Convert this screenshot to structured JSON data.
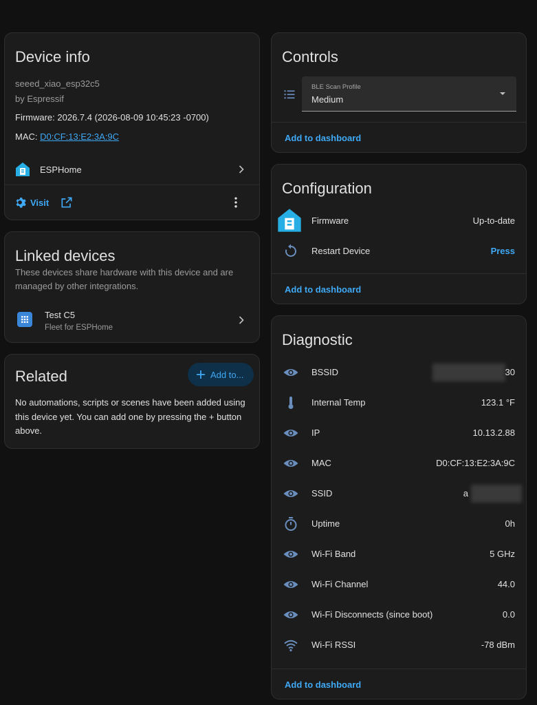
{
  "device_info": {
    "title": "Device info",
    "model": "seeed_xiao_esp32c5",
    "manufacturer": "by Espressif",
    "firmware": "Firmware: 2026.7.4 (2026-08-09 10:45:23 -0700)",
    "mac_label": "MAC: ",
    "mac_value": "D0:CF:13:E2:3A:9C",
    "integration": "ESPHome",
    "visit_label": "Visit"
  },
  "linked_devices": {
    "title": "Linked devices",
    "description": "These devices share hardware with this device and are managed by other integrations.",
    "items": [
      {
        "name": "Test C5",
        "subtitle": "Fleet for ESPHome"
      }
    ]
  },
  "related": {
    "title": "Related",
    "add_button": "Add to...",
    "message": "No automations, scripts or scenes have been added using this device yet. You can add one by pressing the + button above."
  },
  "controls": {
    "title": "Controls",
    "select_label": "BLE Scan Profile",
    "select_value": "Medium",
    "add_to_dashboard": "Add to dashboard"
  },
  "configuration": {
    "title": "Configuration",
    "rows": [
      {
        "label": "Firmware",
        "value": "Up-to-date"
      },
      {
        "label": "Restart Device",
        "value": "Press"
      }
    ],
    "add_to_dashboard": "Add to dashboard"
  },
  "diagnostic": {
    "title": "Diagnostic",
    "rows": [
      {
        "label": "BSSID",
        "value": "30",
        "icon": "eye-icon"
      },
      {
        "label": "Internal Temp",
        "value": "123.1 °F",
        "icon": "thermometer-icon"
      },
      {
        "label": "IP",
        "value": "10.13.2.88",
        "icon": "eye-icon"
      },
      {
        "label": "MAC",
        "value": "D0:CF:13:E2:3A:9C",
        "icon": "eye-icon"
      },
      {
        "label": "SSID",
        "value": "a",
        "icon": "eye-icon"
      },
      {
        "label": "Uptime",
        "value": "0h",
        "icon": "timer-icon"
      },
      {
        "label": "Wi-Fi Band",
        "value": "5 GHz",
        "icon": "eye-icon"
      },
      {
        "label": "Wi-Fi Channel",
        "value": "44.0",
        "icon": "eye-icon"
      },
      {
        "label": "Wi-Fi Disconnects (since boot)",
        "value": "0.0",
        "icon": "eye-icon"
      },
      {
        "label": "Wi-Fi RSSI",
        "value": "-78 dBm",
        "icon": "wifi-icon"
      }
    ],
    "add_to_dashboard": "Add to dashboard"
  },
  "colors": {
    "background": "#111111",
    "card": "#1c1c1c",
    "accent": "#3fa9f5",
    "icon": "#6a8fbf",
    "esphome_brand": "#27aee4"
  }
}
